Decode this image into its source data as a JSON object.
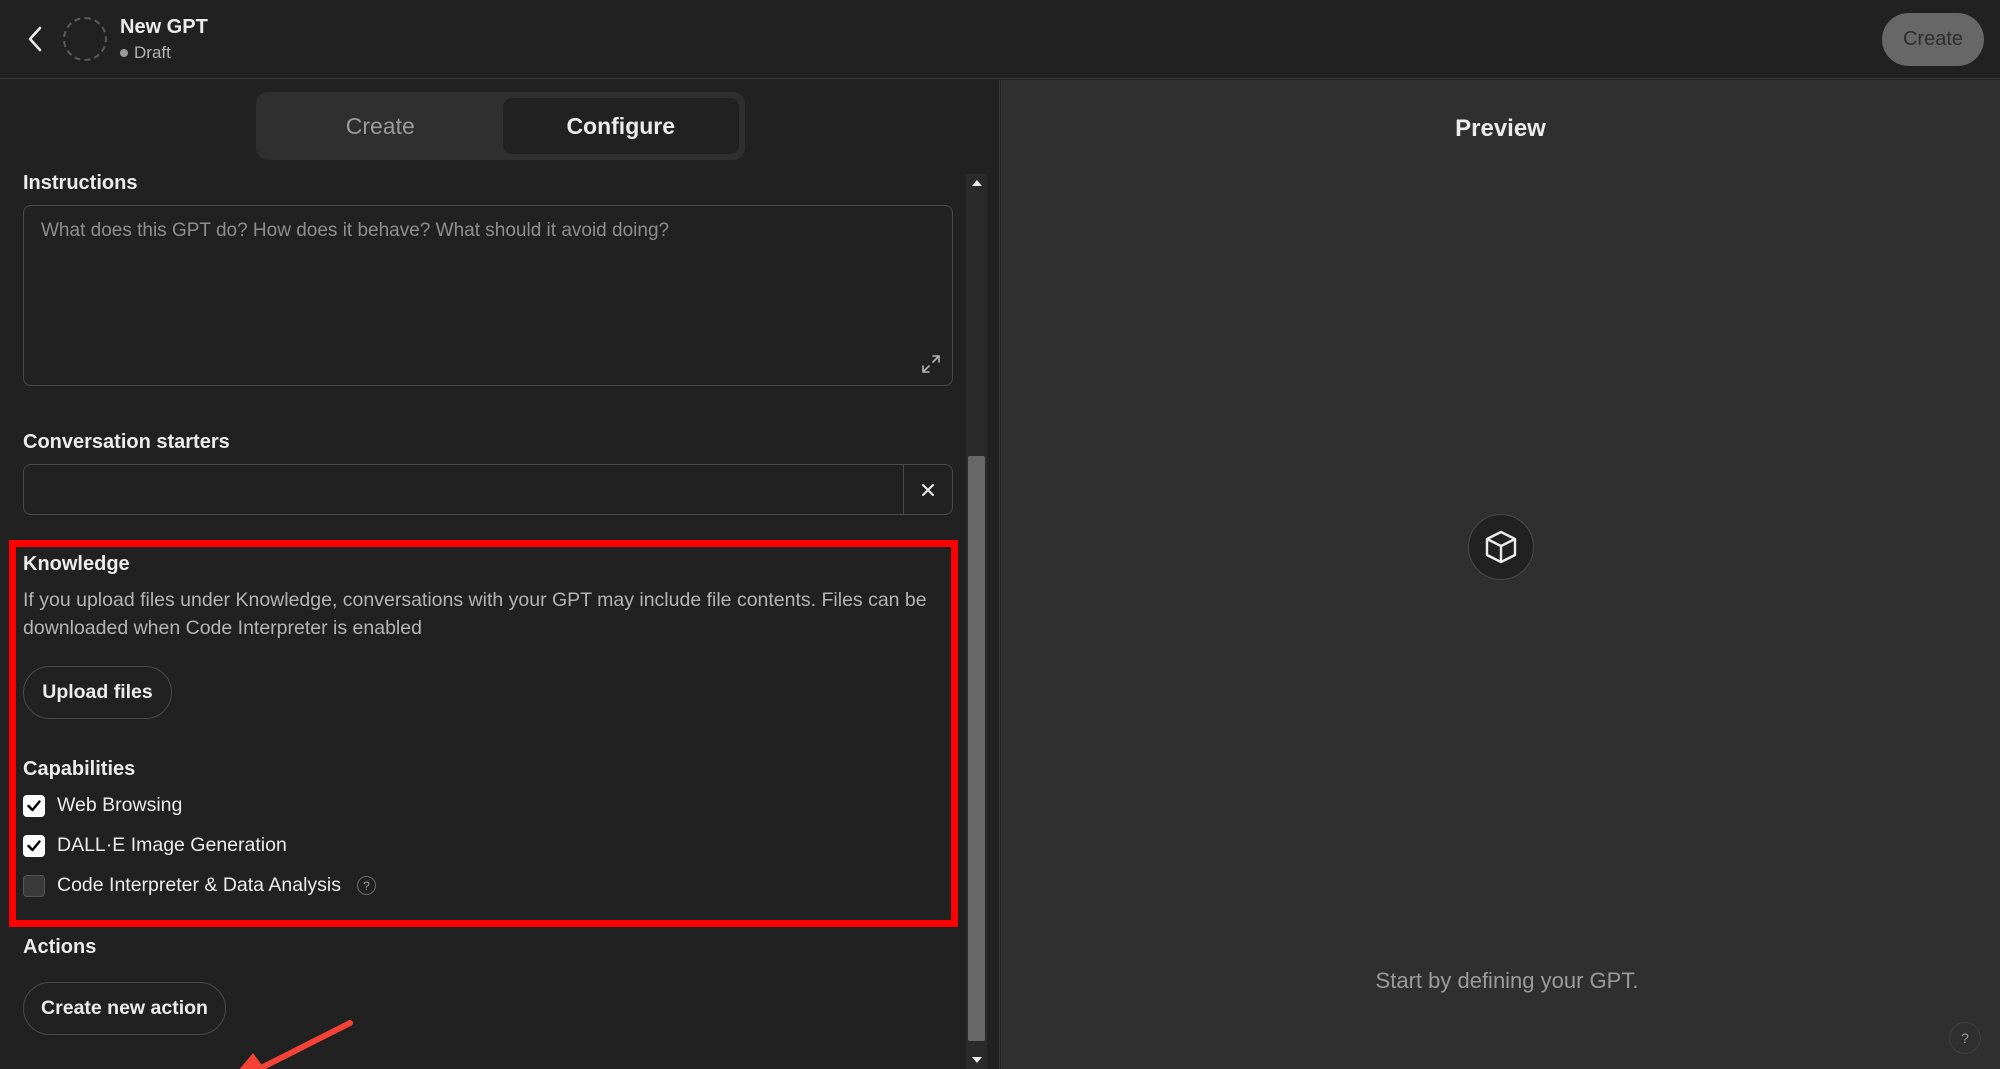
{
  "header": {
    "title": "New GPT",
    "status": "Draft",
    "create_button": "Create"
  },
  "tabs": [
    {
      "label": "Create",
      "active": false
    },
    {
      "label": "Configure",
      "active": true
    }
  ],
  "instructions": {
    "label": "Instructions",
    "placeholder": "What does this GPT do? How does it behave? What should it avoid doing?",
    "value": ""
  },
  "conversation_starters": {
    "label": "Conversation starters",
    "value": ""
  },
  "knowledge": {
    "label": "Knowledge",
    "description": "If you upload files under Knowledge, conversations with your GPT may include file contents. Files can be downloaded when Code Interpreter is enabled",
    "upload_button": "Upload files"
  },
  "capabilities": {
    "label": "Capabilities",
    "items": [
      {
        "label": "Web Browsing",
        "checked": true
      },
      {
        "label": "DALL·E Image Generation",
        "checked": true
      },
      {
        "label": "Code Interpreter & Data Analysis",
        "checked": false,
        "help": "?"
      }
    ]
  },
  "actions": {
    "label": "Actions",
    "create_button": "Create new action"
  },
  "preview": {
    "title": "Preview",
    "hint": "Start by defining your GPT.",
    "help": "?"
  },
  "annotation": {
    "color": "#ff0000"
  },
  "icons": [
    "back-chevron-icon",
    "expand-icon",
    "close-icon",
    "checkmark-icon",
    "cube-icon",
    "help-icon",
    "scroll-up-icon",
    "scroll-down-icon"
  ]
}
